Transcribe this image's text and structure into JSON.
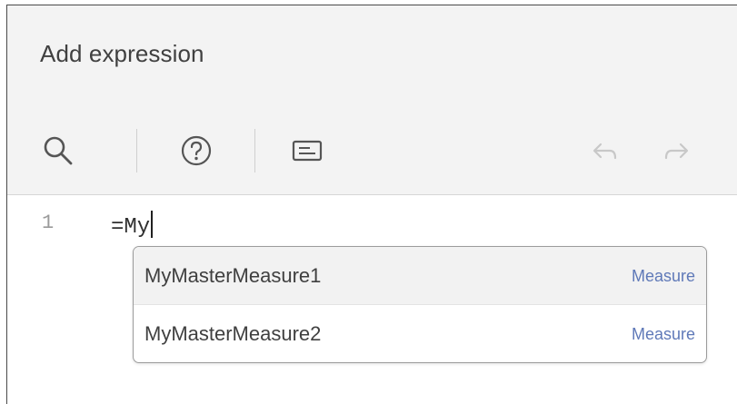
{
  "dialog": {
    "title": "Add expression"
  },
  "toolbar": {
    "search_icon": "search-icon",
    "help_icon": "help-icon",
    "comment_icon": "comment-icon",
    "undo_icon": "undo-icon",
    "redo_icon": "redo-icon"
  },
  "editor": {
    "line_number": "1",
    "code": "=My"
  },
  "suggestions": [
    {
      "label": "MyMasterMeasure1",
      "type": "Measure"
    },
    {
      "label": "MyMasterMeasure2",
      "type": "Measure"
    }
  ],
  "colors": {
    "accent": "#5f79b8",
    "header_bg": "#f3f3f3",
    "text": "#404040"
  }
}
